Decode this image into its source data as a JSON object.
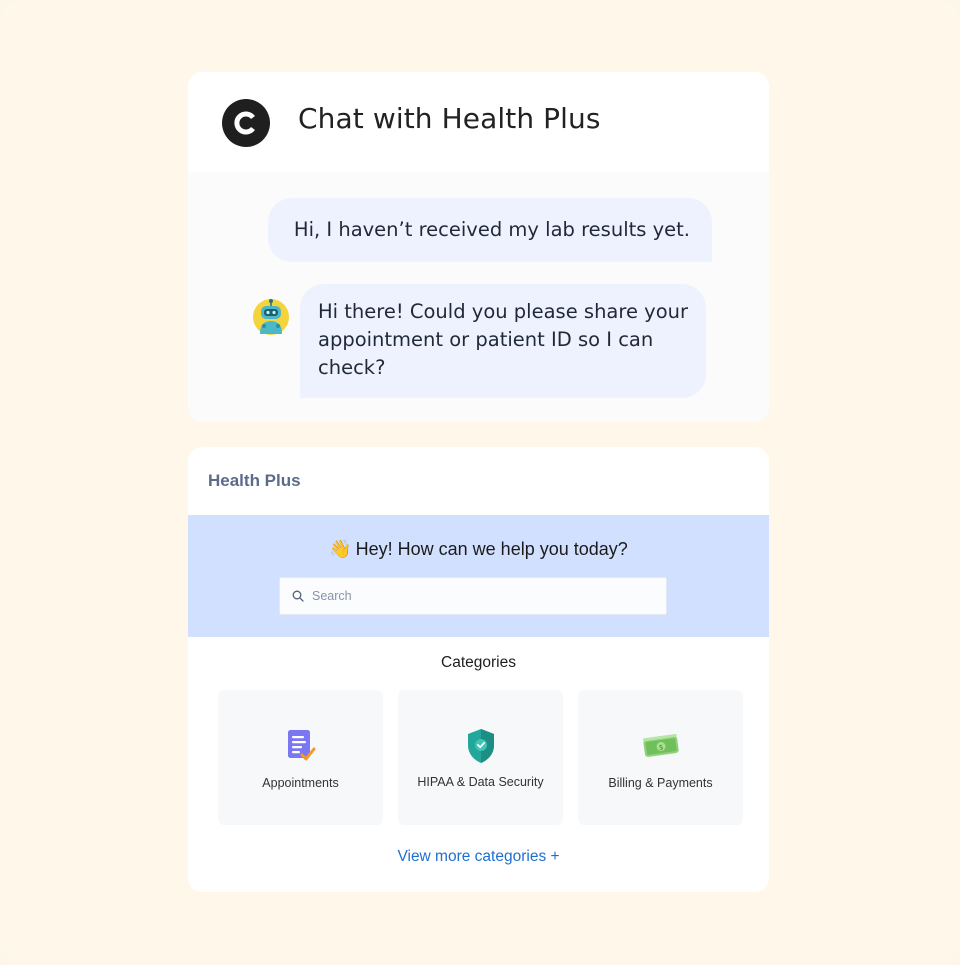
{
  "chat": {
    "title": "Chat with Health Plus",
    "messages": [
      {
        "sender": "user",
        "text": "Hi, I haven’t received my lab results yet."
      },
      {
        "sender": "bot",
        "text": "Hi there! Could you please share your appointment or patient ID so I can check?"
      }
    ]
  },
  "help_widget": {
    "brand": "Health Plus",
    "hero_emoji": "👋",
    "hero_title": "Hey! How can we help you today?",
    "search_placeholder": "Search",
    "categories_heading": "Categories",
    "categories": [
      {
        "label": "Appointments",
        "icon": "document-icon"
      },
      {
        "label": "HIPAA & Data Security",
        "icon": "shield-icon"
      },
      {
        "label": "Billing & Payments",
        "icon": "money-icon"
      }
    ],
    "view_more": "View more categories +"
  },
  "colors": {
    "page_background": "#fff8ea",
    "hero_background": "#d2e0ff",
    "bubble_background": "#eef2ff",
    "link": "#1f6fd1"
  }
}
